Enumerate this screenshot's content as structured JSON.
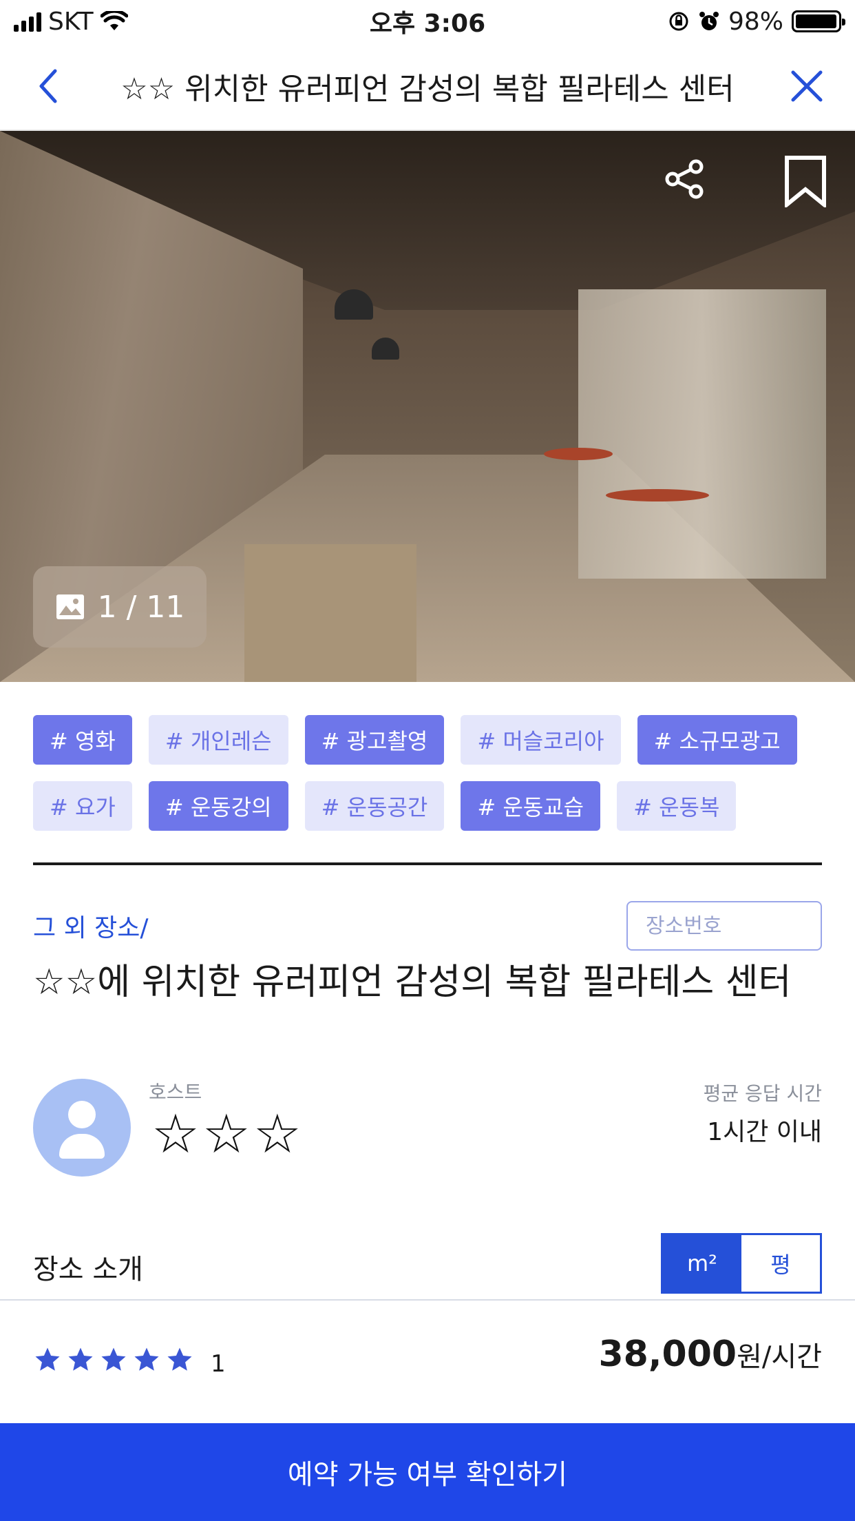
{
  "status_bar": {
    "carrier": "SKT",
    "time": "오후 3:06",
    "battery": "98%",
    "battery_level": 0.98
  },
  "header": {
    "back_icon": "chevron-left-icon",
    "title": "☆☆ 위치한 유러피언 감성의 복합 필라테스 센터",
    "close_icon": "close-icon"
  },
  "gallery": {
    "share_icon": "share-icon",
    "bookmark_icon": "bookmark-icon",
    "image_icon": "image-icon",
    "counter": "1 / 11"
  },
  "tags": [
    {
      "label": "# 영화",
      "style": "dark"
    },
    {
      "label": "# 개인레슨",
      "style": "light"
    },
    {
      "label": "# 광고촬영",
      "style": "dark"
    },
    {
      "label": "# 머슬코리아",
      "style": "light"
    },
    {
      "label": "# 소규모광고",
      "style": "dark"
    },
    {
      "label": "# 요가",
      "style": "light"
    },
    {
      "label": "# 운동강의",
      "style": "dark"
    },
    {
      "label": "# 운동공간",
      "style": "light"
    },
    {
      "label": "# 운동교습",
      "style": "dark"
    },
    {
      "label": "# 운동복",
      "style": "light"
    }
  ],
  "place": {
    "category": "그 외 장소/",
    "number_placeholder": "장소번호",
    "title": "☆☆에 위치한 유러피언 감성의 복합 필라테스 센터"
  },
  "host": {
    "label": "호스트",
    "name": "☆☆☆",
    "avatar_icon": "user-icon",
    "response_label": "평균 응답 시간",
    "response_value": "1시간 이내"
  },
  "intro": {
    "label": "장소 소개",
    "unit_m2": "m²",
    "unit_pyeong": "평",
    "selected_unit": "m²"
  },
  "footer": {
    "rating": 5,
    "review_count": "1",
    "price": "38,000",
    "price_unit": "원/시간",
    "cta": "예약 가능 여부 확인하기"
  },
  "colors": {
    "accent": "#2550d8",
    "cta": "#1f47e8",
    "tag_dark": "#6e76ea",
    "tag_light": "#e4e6fb",
    "star": "#3a56d4"
  }
}
